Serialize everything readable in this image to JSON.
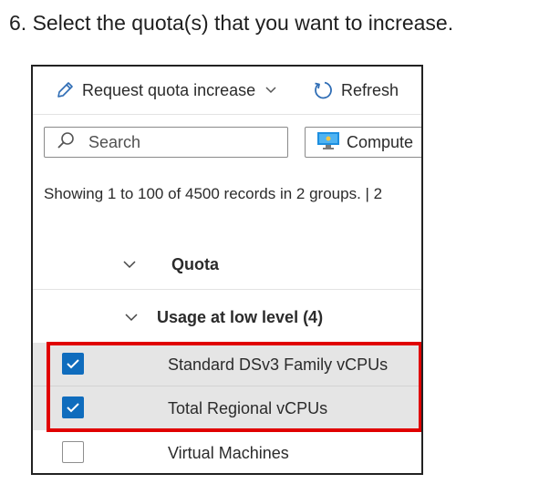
{
  "instruction": "6. Select the quota(s) that you want to increase.",
  "toolbar": {
    "request_label": "Request quota increase",
    "refresh_label": "Refresh"
  },
  "search": {
    "placeholder": "Search"
  },
  "filter": {
    "label": "Compute"
  },
  "records_text": "Showing 1 to 100 of 4500 records in 2 groups. | 2",
  "table": {
    "column_header": "Quota",
    "group_title": "Usage at low level (4)",
    "rows": [
      {
        "label": "Standard DSv3 Family vCPUs",
        "checked": true
      },
      {
        "label": "Total Regional vCPUs",
        "checked": true
      },
      {
        "label": "Virtual Machines",
        "checked": false
      }
    ]
  },
  "colors": {
    "checkbox_checked": "#0f6cbd",
    "highlight_border": "#e00000",
    "selected_row_bg": "#e5e5e5"
  }
}
